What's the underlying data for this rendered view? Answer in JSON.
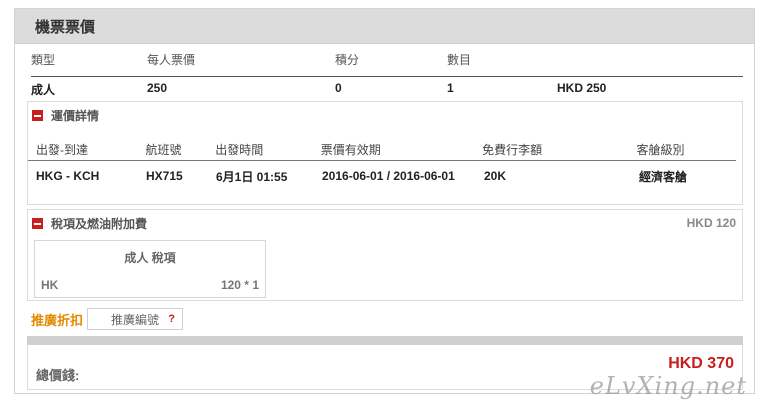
{
  "header": {
    "title": "機票票價"
  },
  "summary": {
    "columns": [
      "類型",
      "每人票價",
      "積分",
      "數目",
      ""
    ],
    "row": [
      "成人",
      "250",
      "0",
      "1",
      "HKD 250"
    ]
  },
  "fare_details": {
    "title": "運價詳情",
    "columns": [
      "出發-到達",
      "航班號",
      "出發時間",
      "票價有效期",
      "免費行李額",
      "客艙級別"
    ],
    "row": [
      "HKG - KCH",
      "HX715",
      "6月1日 01:55",
      "2016-06-01 / 2016-06-01",
      "20K",
      "經濟客艙"
    ]
  },
  "taxes": {
    "title": "稅項及燃油附加費",
    "amount": "HKD 120",
    "card_title": "成人 稅項",
    "card_code": "HK",
    "card_value": "120 * 1"
  },
  "promo": {
    "label": "推廣折扣",
    "input_placeholder": "推廣編號",
    "help": "?"
  },
  "total": {
    "label": "總價錢:",
    "amount": "HKD 370"
  },
  "watermark": "eLvXing.net",
  "colors": {
    "accent_red": "#c81e1e",
    "promo_orange": "#e58a00"
  }
}
